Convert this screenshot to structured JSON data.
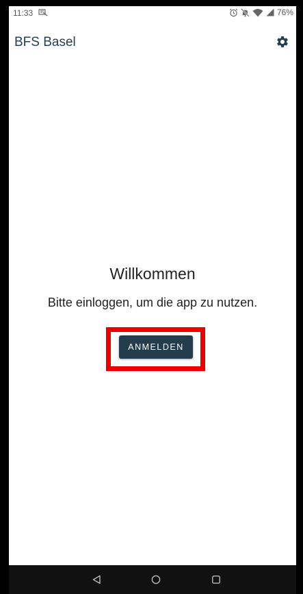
{
  "status_bar": {
    "time": "11:33",
    "battery": "76%",
    "icons": [
      "notification-icon",
      "alarm-icon",
      "mute-icon",
      "wifi-icon",
      "signal-icon"
    ]
  },
  "app_bar": {
    "title": "BFS Basel",
    "settings_icon": "gear-icon"
  },
  "main": {
    "welcome_title": "Willkommen",
    "welcome_subtitle": "Bitte einloggen, um die app zu nutzen.",
    "login_button": "ANMELDEN"
  },
  "nav_bar": {
    "icons": [
      "back-icon",
      "home-icon",
      "recents-icon"
    ]
  },
  "colors": {
    "primary": "#233d4c",
    "title": "#24404f",
    "highlight": "#ee0000"
  }
}
